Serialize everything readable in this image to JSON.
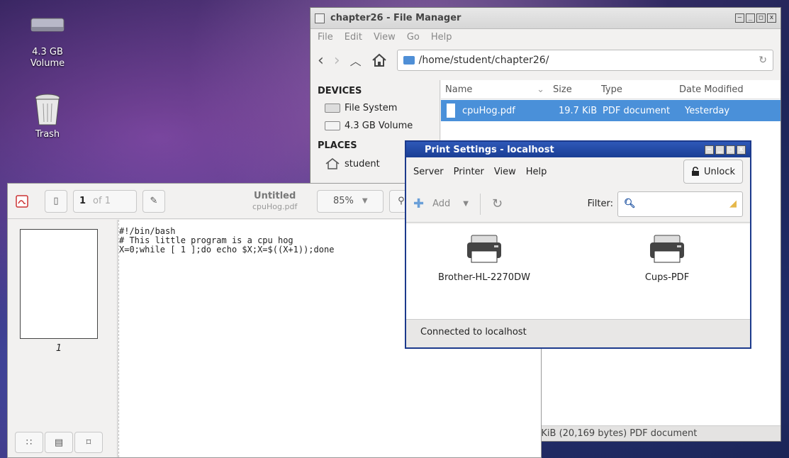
{
  "desktop": {
    "volume_label": "4.3 GB\nVolume",
    "volume_line1": "4.3 GB",
    "volume_line2": "Volume",
    "trash_label": "Trash"
  },
  "file_manager": {
    "title": "chapter26 - File Manager",
    "menu": [
      "File",
      "Edit",
      "View",
      "Go",
      "Help"
    ],
    "path": "/home/student/chapter26/",
    "sidebar": {
      "devices_header": "DEVICES",
      "devices": [
        "File System",
        "4.3 GB Volume"
      ],
      "places_header": "PLACES",
      "places": [
        "student"
      ]
    },
    "columns": [
      "Name",
      "Size",
      "Type",
      "Date Modified"
    ],
    "files": [
      {
        "name": "cpuHog.pdf",
        "size": "19.7 KiB",
        "type": "PDF document",
        "modified": "Yesterday"
      }
    ],
    "status": "7 KiB (20,169 bytes) PDF document"
  },
  "pdf_viewer": {
    "page_current": "1",
    "page_of": "of 1",
    "title": "Untitled",
    "subtitle": "cpuHog.pdf",
    "zoom": "85%",
    "thumb_number": "1",
    "content": "#!/bin/bash\n# This little program is a cpu hog\nX=0;while [ 1 ];do echo $X;X=$((X+1));done"
  },
  "print_settings": {
    "title": "Print Settings - localhost",
    "menu": [
      "Server",
      "Printer",
      "View",
      "Help"
    ],
    "unlock_label": "Unlock",
    "add_label": "Add",
    "filter_label": "Filter:",
    "printers": [
      "Brother-HL-2270DW",
      "Cups-PDF"
    ],
    "status": "Connected to localhost"
  },
  "colors": {
    "selection": "#4a90d9",
    "titlebar_active": "#1a3e94"
  }
}
